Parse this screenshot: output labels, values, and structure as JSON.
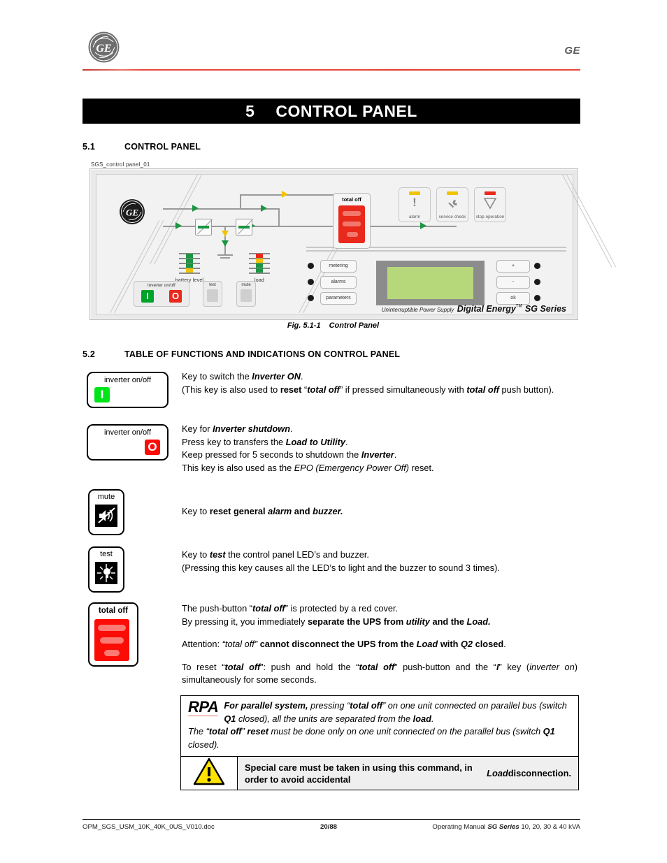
{
  "header": {
    "logo_alt": "GE monogram logo",
    "right_text": "GE"
  },
  "chapter": {
    "number": "5",
    "title": "CONTROL PANEL"
  },
  "sections": {
    "s51": {
      "number": "5.1",
      "title": "CONTROL PANEL"
    },
    "s52": {
      "number": "5.2",
      "title": "TABLE OF FUNCTIONS AND INDICATIONS ON CONTROL PANEL"
    }
  },
  "figure": {
    "image_tag": "SGS_control panel_01",
    "caption_number": "Fig. 5.1-1",
    "caption_title": "Control Panel",
    "panel": {
      "total_off_label": "total off",
      "battery_level_label": "battery level",
      "load_label": "load",
      "status_keys": [
        {
          "name": "alarm",
          "label": "alarm",
          "led_color": "#f2c300",
          "glyph": "!"
        },
        {
          "name": "service-check",
          "label": "service check",
          "led_color": "#f2c300",
          "glyph": "wrench"
        },
        {
          "name": "stop-operation",
          "label": "stop operation",
          "led_color": "#e8291c",
          "glyph": "triangle-down"
        }
      ],
      "inverter_cluster_label": "inverter on/off",
      "inverter_on_glyph": "I",
      "inverter_off_glyph": "O",
      "test_label": "test",
      "mute_label": "mute",
      "menu_buttons": [
        "metering",
        "alarms",
        "parameters"
      ],
      "nav_buttons": [
        "+",
        "-",
        "ok"
      ],
      "brand_prefix": "Uninterruptible Power Supply",
      "brand_name": "Digital Energy",
      "brand_tm": "TM",
      "brand_series": "SG Series",
      "lcd_color": "#b6d77a"
    }
  },
  "table_rows": [
    {
      "key_name": "inverter-on-key",
      "key_label": "inverter on/off",
      "key_glyph": "I",
      "key_glyph_color": "#00e519",
      "lines": [
        "Key to switch the <b><i>Inverter ON</i></b>.",
        "(This key is also used to <b>reset</b> &ldquo;<b><i>total off</i></b>&rdquo; if pressed simultaneously with <b><i>total off</i></b> push button)."
      ]
    },
    {
      "key_name": "inverter-off-key",
      "key_label": "inverter on/off",
      "key_glyph": "O",
      "key_glyph_color": "#fb0c06",
      "lines": [
        "Key for <b><i>Inverter shutdown</i></b>.",
        "Press key to transfers the <b><i>Load to Utility</i></b>.",
        "Keep pressed for 5 seconds to shutdown the <b><i>Inverter</i></b>.",
        "This key is also used as the <i>EPO (Emergency Power Off)</i> reset."
      ]
    },
    {
      "key_name": "mute-key",
      "key_label": "mute",
      "key_glyph": "mute-icon",
      "lines": [
        "Key to <b>reset general</b> <b><i>alarm</i></b> <b>and</b> <b><i>buzzer.</i></b>"
      ]
    },
    {
      "key_name": "test-key",
      "key_label": "test",
      "key_glyph": "test-icon",
      "lines": [
        "Key to <b><i>test</i></b> the control panel LED&rsquo;s and buzzer.",
        "(Pressing this key causes all the LED&rsquo;s to light and the buzzer to sound 3 times)."
      ]
    },
    {
      "key_name": "total-off-key",
      "key_label": "total off",
      "key_glyph": "total-off-cover",
      "lines": [
        "The push-button &ldquo;<b><i>total off</i></b>&rdquo; is protected by a red cover.",
        "By pressing it, you immediately <b>separate the UPS from</b> <b><i>utility</i></b> <b>and the</b> <b><i>Load.</i></b>",
        "Attention: <i>&ldquo;total off&rdquo;</i> <b>cannot disconnect the UPS from the</b> <b><i>Load</i></b> <b>with</b> <b><i>Q2</i></b> <b>closed</b>.",
        "To reset &ldquo;<b><i>total off</i></b>&rdquo;: push and hold the &ldquo;<b><i>total off</i></b>&rdquo; push-button and the &ldquo;<b><i>I</i></b>&rdquo; key (<i>inverter on</i>) simultaneously for some seconds."
      ]
    }
  ],
  "rpa": {
    "logo": "RPA",
    "text": "<b>For parallel system,</b> pressing &ldquo;<b>total off</b>&rdquo; on one unit connected on parallel bus (switch <b>Q1</b> closed), all the units are separated from the <b>load</b>.<br>The &ldquo;<b>total off</b>&rdquo; <b>reset</b> must be done only on one unit connected on the parallel bus (switch <b>Q1</b> closed)."
  },
  "warning": {
    "icon": "warning-triangle-icon",
    "text": "Special care must be taken in using this command, in order to avoid accidental <i>Load</i> disconnection."
  },
  "footer": {
    "left": "OPM_SGS_USM_10K_40K_0US_V010.doc",
    "page": "20/88",
    "right_prefix": "Operating Manual",
    "right_series": "SG Series",
    "right_suffix": "10, 20, 30 &amp; 40 kVA"
  },
  "colors": {
    "accent_red": "#e8483a",
    "led_green": "#1a9641",
    "led_yellow": "#f2c300",
    "led_red": "#e8291c",
    "lcd_green": "#b6d77a",
    "warning_yellow": "#ffe400"
  }
}
